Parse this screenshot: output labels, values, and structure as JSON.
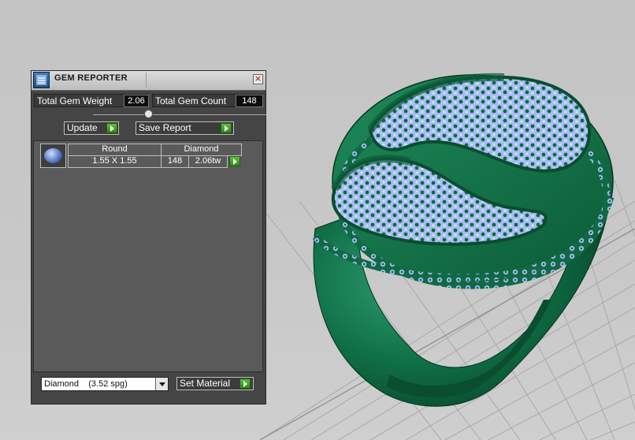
{
  "panel": {
    "title": "GEM REPORTER",
    "close_symbol": "×",
    "total_weight_label": "Total Gem Weight",
    "total_weight_value": "2.06",
    "total_count_label": "Total Gem Count",
    "total_count_value": "148",
    "update_label": "Update",
    "save_report_label": "Save Report",
    "gem_row": {
      "shape": "Round",
      "material": "Diamond",
      "size": "1.55 X 1.55",
      "count": "148",
      "weight": "2.06tw"
    },
    "material_select": "Diamond    (3.52 spg)",
    "set_material_label": "Set Material"
  },
  "icons": {
    "title_icon": "gem-reporter-icon",
    "close": "close-icon",
    "go": "green-arrow-icon",
    "gem": "gem-thumbnail-icon",
    "dropdown": "chevron-down-icon"
  },
  "colors": {
    "ring_green": "#0e6b43",
    "gem_blue": "#9eb3ee",
    "panel_bg": "#454545",
    "go_green": "#3fa326"
  }
}
